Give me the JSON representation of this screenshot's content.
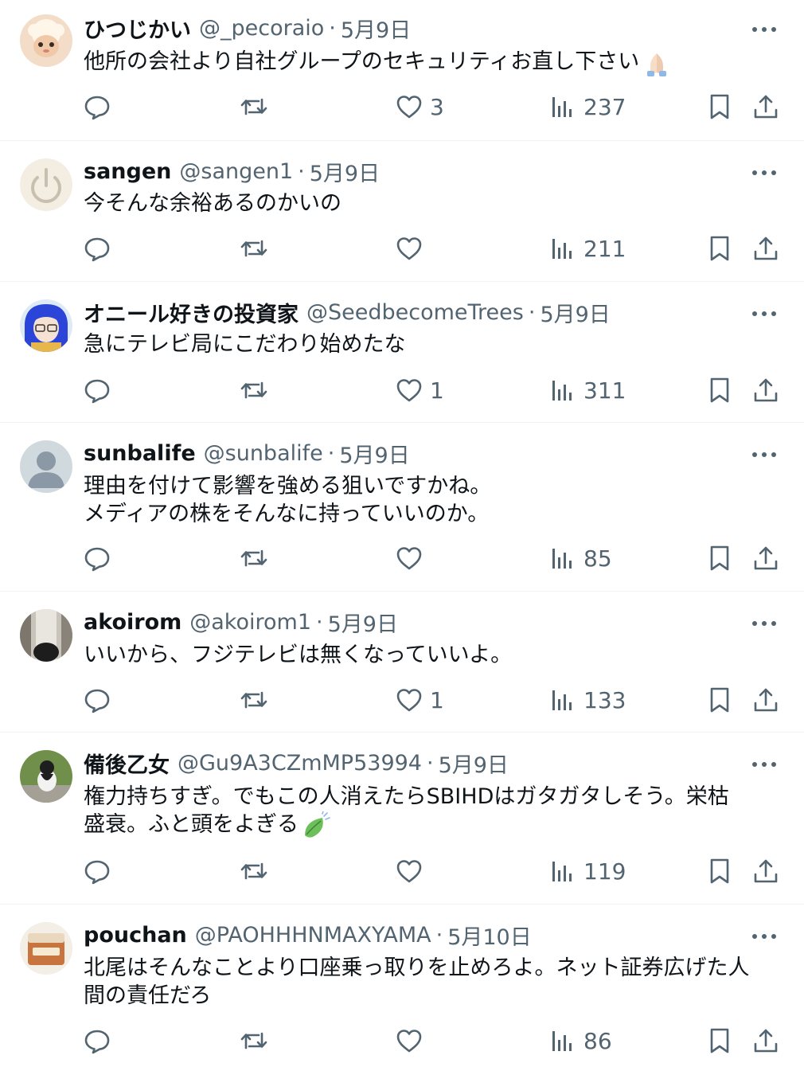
{
  "tweets": [
    {
      "name": "ひつじかい",
      "handle": "@_pecoraio",
      "sep": "·",
      "date": "5月9日",
      "lines": [
        "他所の会社より自社グループのセキュリティお直し下さい"
      ],
      "emoji": "folded-hands",
      "likes": "3",
      "views": "237"
    },
    {
      "name": "sangen",
      "handle": "@sangen1",
      "sep": "·",
      "date": "5月9日",
      "lines": [
        "今そんな余裕あるのかいの"
      ],
      "likes": "",
      "views": "211"
    },
    {
      "name": "オニール好きの投資家",
      "handle": "@SeedbecomeTrees",
      "sep": "·",
      "date": "5月9日",
      "lines": [
        "急にテレビ局にこだわり始めたな"
      ],
      "likes": "1",
      "views": "311"
    },
    {
      "name": "sunbalife",
      "handle": "@sunbalife",
      "sep": "·",
      "date": "5月9日",
      "lines": [
        "理由を付けて影響を強める狙いですかね。",
        "メディアの株をそんなに持っていいのか。"
      ],
      "likes": "",
      "views": "85"
    },
    {
      "name": "akoirom",
      "handle": "@akoirom1",
      "sep": "·",
      "date": "5月9日",
      "lines": [
        "いいから、フジテレビは無くなっていいよ。"
      ],
      "likes": "1",
      "views": "133"
    },
    {
      "name": "備後乙女",
      "handle": "@Gu9A3CZmMP53994",
      "sep": "·",
      "date": "5月9日",
      "lines": [
        "権力持ちすぎ。でもこの人消えたらSBIHDはガタガタしそう。栄枯",
        "盛衰。ふと頭をよぎる"
      ],
      "emoji": "leaf-fluttering",
      "likes": "",
      "views": "119"
    },
    {
      "name": "pouchan",
      "handle": "@PAOHHHNMAXYAMA",
      "sep": "·",
      "date": "5月10日",
      "lines": [
        "北尾はそんなことより口座乗っ取りを止めろよ。ネット証券広げた人",
        "間の責任だろ"
      ],
      "likes": "",
      "views": "86"
    }
  ]
}
